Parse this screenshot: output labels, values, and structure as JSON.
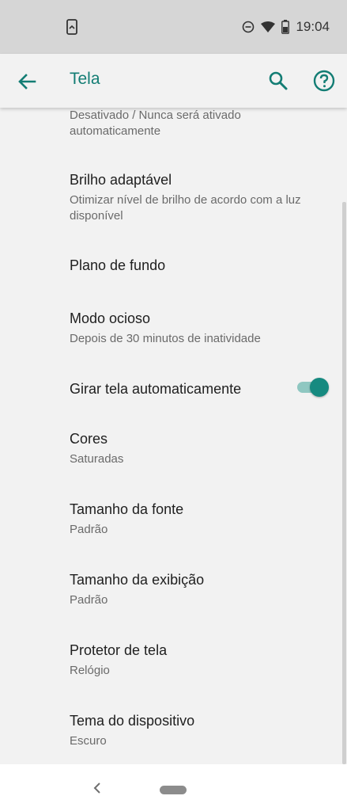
{
  "status_bar": {
    "time": "19:04",
    "left_icon": "phone-screenshot-icon",
    "icons": [
      "do-not-disturb-icon",
      "wifi-icon",
      "battery-icon"
    ]
  },
  "app_bar": {
    "title": "Tela",
    "back_icon": "arrow-back-icon",
    "search_icon": "search-icon",
    "help_icon": "help-icon"
  },
  "settings": [
    {
      "id": "partial",
      "subtitle": "Desativado / Nunca será ativado automaticamente"
    },
    {
      "id": "brilho",
      "title": "Brilho adaptável",
      "subtitle": "Otimizar nível de brilho de acordo com a luz disponível"
    },
    {
      "id": "plano",
      "title": "Plano de fundo"
    },
    {
      "id": "ocioso",
      "title": "Modo ocioso",
      "subtitle": "Depois de 30 minutos de inatividade"
    },
    {
      "id": "girar",
      "title": "Girar tela automaticamente",
      "toggle": true
    },
    {
      "id": "cores",
      "title": "Cores",
      "subtitle": "Saturadas"
    },
    {
      "id": "fonte",
      "title": "Tamanho da fonte",
      "subtitle": "Padrão"
    },
    {
      "id": "exibicao",
      "title": "Tamanho da exibição",
      "subtitle": "Padrão"
    },
    {
      "id": "protetor",
      "title": "Protetor de tela",
      "subtitle": "Relógio"
    },
    {
      "id": "tema",
      "title": "Tema do dispositivo",
      "subtitle": "Escuro"
    }
  ],
  "colors": {
    "accent": "#137d74",
    "toggle_on": "#168a80",
    "toggle_track": "#8fc7c1",
    "background": "#f2f2f2"
  },
  "nav_bar": {
    "back_icon": "nav-back-icon",
    "home_icon": "nav-home-pill-icon"
  }
}
